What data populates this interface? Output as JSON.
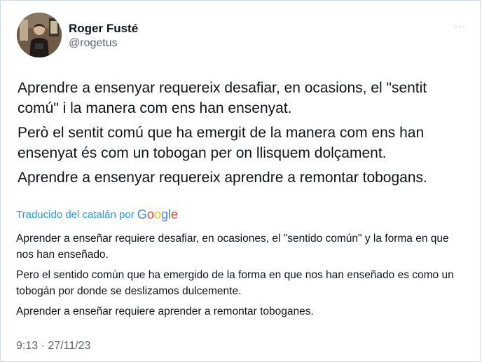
{
  "author": {
    "display_name": "Roger Fusté",
    "handle": "@rogetus"
  },
  "more_label": "···",
  "tweet": {
    "paragraphs": [
      "Aprendre a ensenyar requereix desafiar, en ocasions, el \"sentit comú\" i la manera com ens han ensenyat.",
      "Però el sentit comú que ha emergit de la manera com ens han ensenyat és com un tobogan per on llisquem dolçament.",
      "Aprendre a ensenyar requereix aprendre a remontar tobogans."
    ]
  },
  "translation": {
    "label": "Traducido del catalán por",
    "provider_letters": [
      "G",
      "o",
      "o",
      "g",
      "l",
      "e"
    ],
    "paragraphs": [
      "Aprender a enseñar requiere desafiar, en ocasiones, el \"sentido común\" y la forma en que nos han enseñado.",
      "Pero el sentido común que ha emergido de la forma en que nos han enseñado es como un tobogán por donde se deslizamos dulcemente.",
      "Aprender a enseñar requiere aprender a remontar toboganes."
    ]
  },
  "timestamp": "9:13 · 27/11/23",
  "colors": {
    "link": "#1d9bf0",
    "secondary_text": "#536471",
    "border": "#cfd9de"
  }
}
